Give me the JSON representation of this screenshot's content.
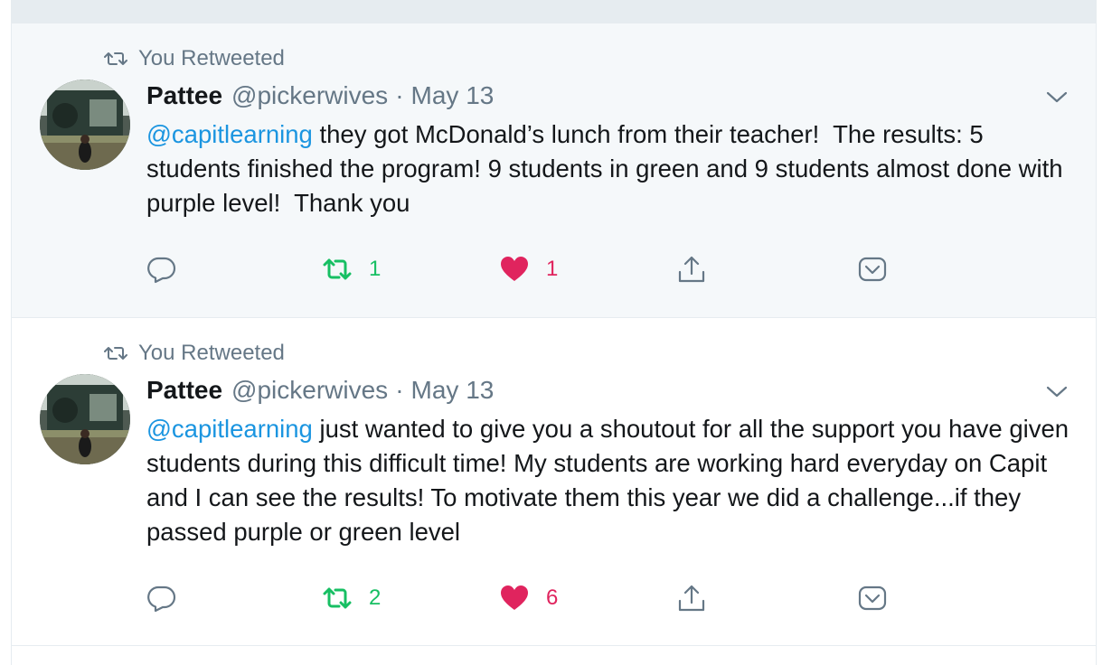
{
  "feed": {
    "tweets": [
      {
        "context_label": "You Retweeted",
        "author_name": "Pattee",
        "author_handle": "@pickerwives",
        "separator": "·",
        "date": "May 13",
        "mention": "@capitlearning",
        "text": " they got McDonald’s lunch from their teacher!  The results: 5 students finished the program! 9 students in green and 9 students almost done with purple level!  Thank you",
        "retweet_count": "1",
        "like_count": "1"
      },
      {
        "context_label": "You Retweeted",
        "author_name": "Pattee",
        "author_handle": "@pickerwives",
        "separator": "·",
        "date": "May 13",
        "mention": "@capitlearning",
        "text": " just wanted to give you a shoutout for all the support you have given students during this difficult time! My students are working hard everyday on Capit and I can see the results! To motivate them this year we did a challenge...if they passed purple or green level",
        "retweet_count": "2",
        "like_count": "6"
      }
    ]
  },
  "colors": {
    "mention": "#1b95e0",
    "retweet": "#17bf63",
    "like": "#e0245e",
    "muted": "#657786"
  },
  "icons": [
    "retweet-icon",
    "chevron-down-icon",
    "reply-icon",
    "heart-icon",
    "share-icon",
    "more-icon"
  ]
}
